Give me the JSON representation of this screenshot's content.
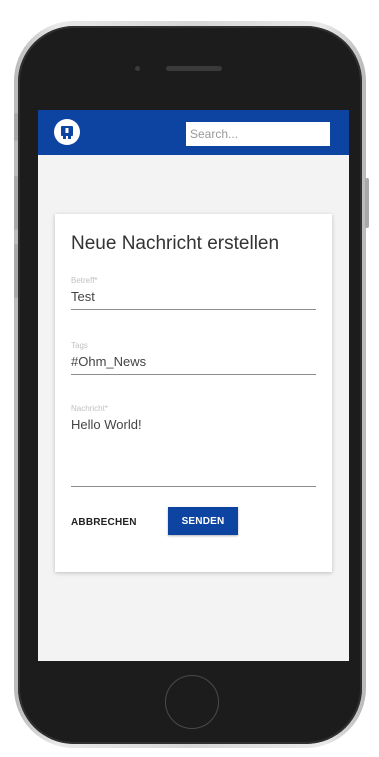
{
  "app": {
    "search_placeholder": "Search...",
    "brand_color": "#0e44a1"
  },
  "form": {
    "title": "Neue Nachricht erstellen",
    "subject": {
      "label": "Betreff*",
      "value": "Test"
    },
    "tags": {
      "label": "Tags",
      "value": "#Ohm_News"
    },
    "message": {
      "label": "Nachricht*",
      "value": "Hello World!"
    },
    "cancel_label": "ABBRECHEN",
    "send_label": "SENDEN"
  },
  "icons": {
    "logo": "app-logo-icon",
    "home": "home-button"
  }
}
